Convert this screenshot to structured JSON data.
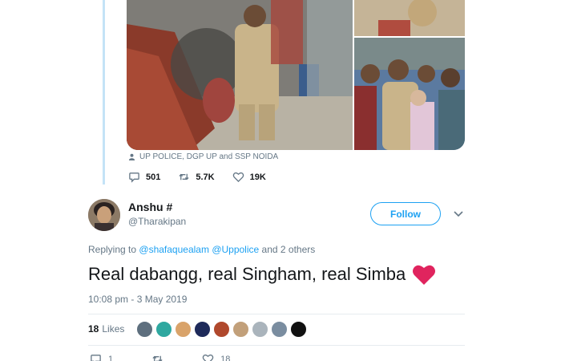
{
  "quoted_tweet": {
    "tagged_icon": "person-icon",
    "tagged_text": "UP POLICE, DGP UP and SSP NOIDA",
    "replies": "501",
    "retweets": "5.7K",
    "likes": "19K"
  },
  "reply": {
    "display_name": "Anshu #",
    "handle": "@Tharakipan",
    "follow_label": "Follow",
    "replying_prefix": "Replying to",
    "mention_1": "@shafaquealam",
    "mention_2": "@Uppolice",
    "replying_suffix": "and 2 others",
    "text": "Real dabangg, real Singham, real Simba",
    "emoji": "red-heart-icon",
    "timestamp": "10:08 pm - 3 May 2019",
    "like_count": "18",
    "like_label": "Likes",
    "bottom_replies": "1",
    "bottom_likes": "18"
  },
  "colors": {
    "accent": "#1da1f2",
    "muted": "#657786",
    "heart": "#e0245e",
    "thread_line": "#c4e3f7"
  }
}
